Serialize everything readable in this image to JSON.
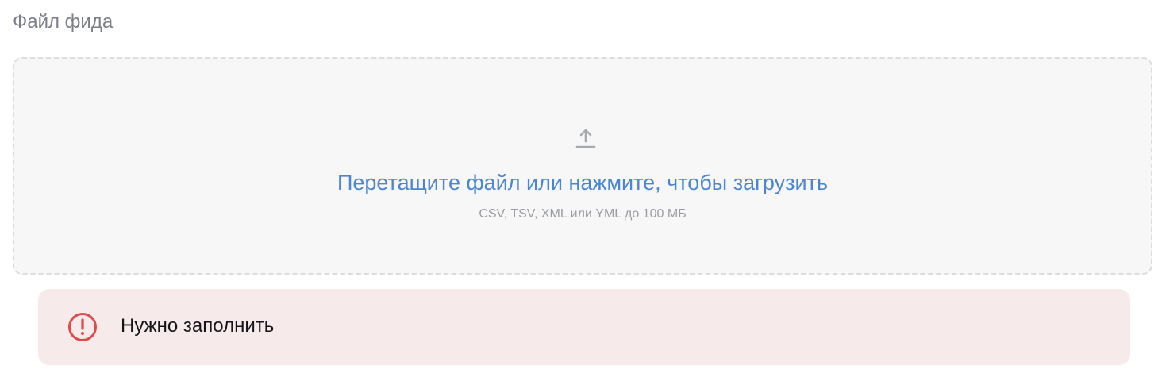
{
  "field": {
    "label": "Файл фида"
  },
  "dropzone": {
    "icon": "upload-icon",
    "title": "Перетащите файл или нажмите, чтобы загрузить",
    "hint": "CSV, TSV, XML или YML до 100 МБ"
  },
  "error": {
    "icon": "exclamation-circle-icon",
    "message": "Нужно заполнить"
  },
  "colors": {
    "accent": "#4a86d1",
    "error_icon": "#e04a4a",
    "error_bg": "#f6eaea",
    "dropzone_bg": "#f7f7f7"
  }
}
